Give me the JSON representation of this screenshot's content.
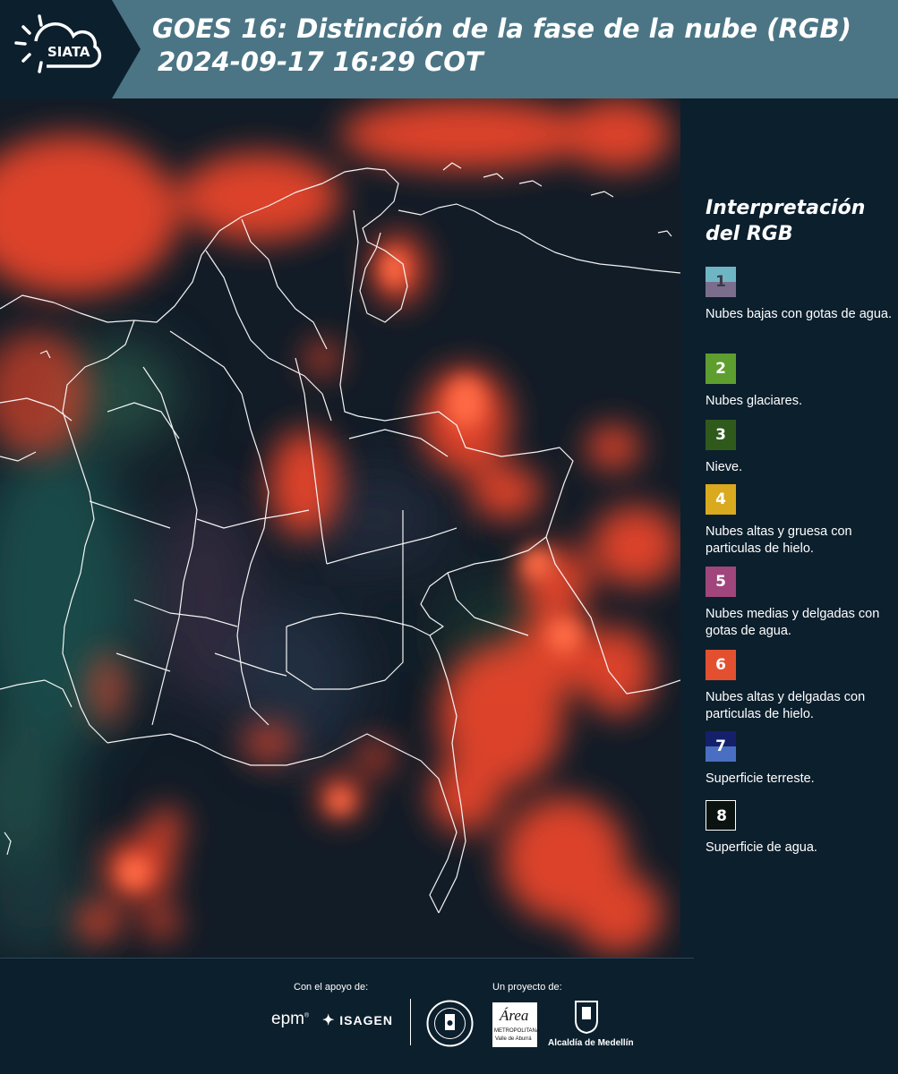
{
  "header": {
    "logo_text": "SIATA",
    "title_line1": "GOES 16: Distinción de la fase de la nube (RGB)",
    "title_line2": "2024-09-17 16:29 COT"
  },
  "legend": {
    "title": "Interpretación del RGB",
    "items": [
      {
        "number": "1",
        "label": "Nubes bajas con gotas de agua.",
        "color_top": "#6fb6c4",
        "color_bottom": "#7b6e8c"
      },
      {
        "number": "2",
        "label": "Nubes glaciares.",
        "color_top": "#5e9e2f",
        "color_bottom": "#5e9e2f"
      },
      {
        "number": "3",
        "label": "Nieve.",
        "color_top": "#2f5a1c",
        "color_bottom": "#2f5a1c"
      },
      {
        "number": "4",
        "label": "Nubes altas y gruesa con particulas de hielo.",
        "color_top": "#d9a91e",
        "color_bottom": "#d9a91e"
      },
      {
        "number": "5",
        "label": "Nubes medias y delgadas con gotas de agua.",
        "color_top": "#a0467c",
        "color_bottom": "#a0467c"
      },
      {
        "number": "6",
        "label": "Nubes altas y delgadas con particulas de hielo.",
        "color_top": "#e35030",
        "color_bottom": "#e35030"
      },
      {
        "number": "7",
        "label": "Superficie terreste.",
        "color_top": "#14206a",
        "color_bottom": "#4a6fc2"
      },
      {
        "number": "8",
        "label": "Superficie de agua.",
        "color_top": "#0a130f",
        "color_bottom": "#0a130f"
      }
    ]
  },
  "footer": {
    "support_label": "Con el apoyo de:",
    "project_label": "Un proyecto de:",
    "epm_text": "epm",
    "isagen_text": "ISAGEN",
    "area_text": "Área",
    "area_sub": "METROPOLITANA",
    "area_sub2": "Valle de Aburrá",
    "alcaldia_text": "Alcaldía de Medellín"
  },
  "colors": {
    "header_bg": "#4b7585",
    "panel_bg": "#0c1f2d",
    "cloud_red": "#ff4a2a"
  }
}
